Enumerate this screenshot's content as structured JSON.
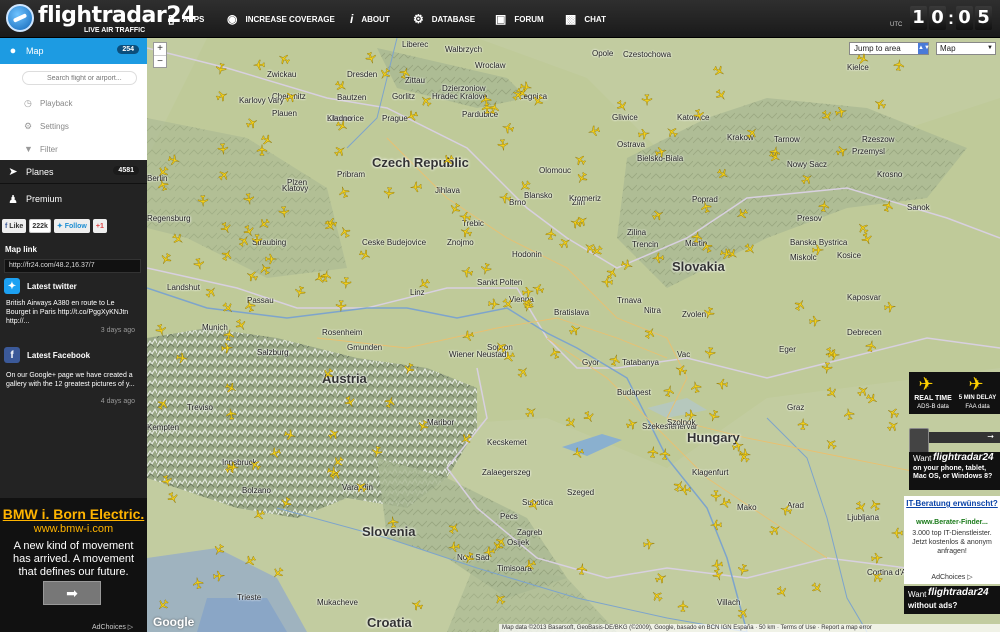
{
  "header": {
    "logo_name": "flightradar24",
    "logo_tagline": "LIVE AIR TRAFFIC",
    "nav": [
      {
        "label": "APPS",
        "icon": "phone-icon"
      },
      {
        "label": "INCREASE COVERAGE",
        "icon": "eye-icon"
      },
      {
        "label": "ABOUT",
        "icon": "info-icon"
      },
      {
        "label": "DATABASE",
        "icon": "database-icon"
      },
      {
        "label": "FORUM",
        "icon": "forum-icon"
      },
      {
        "label": "CHAT",
        "icon": "chat-icon"
      }
    ],
    "utc_label": "UTC",
    "clock": {
      "h1": "1",
      "h2": "0",
      "m1": "0",
      "m2": "5"
    }
  },
  "sidebar": {
    "map_label": "Map",
    "map_count": "254",
    "search_placeholder": "Search flight or airport...",
    "submenu": [
      "Playback",
      "Settings",
      "Filter"
    ],
    "planes_label": "Planes",
    "planes_count": "4581",
    "premium_label": "Premium",
    "social": {
      "like": "Like",
      "like_count": "222k",
      "follow": "Follow",
      "plus": "+1"
    },
    "map_link_title": "Map link",
    "map_link_url": "http://fr24.com/48.2,16.37/7",
    "twitter_title": "Latest twitter",
    "twitter_text": "British Airways A380 en route to Le Bourget in Paris http://t.co/PggXyKNJtn http://...",
    "twitter_date": "3 days ago",
    "facebook_title": "Latest Facebook",
    "facebook_text": "On our Google+ page we have created a gallery with the 12 greatest pictures of y...",
    "facebook_date": "4 days ago"
  },
  "ad": {
    "title": "BMW i. Born Electric.",
    "url": "www.bmw-i.com",
    "body": "A new kind of movement has arrived. A movement that defines our future.",
    "button": "➡",
    "adchoices": "AdChoices ▷"
  },
  "map": {
    "jump_label": "Jump to area",
    "map_type": "Map",
    "zoom_in": "+",
    "zoom_out": "−",
    "google": "Google",
    "attribution": "Map data ©2013 Basarsoft, GeoBasis-DE/BKG (©2009), Google, basado en BCN IGN España · 50 km · Terms of Use · Report a map error",
    "countries": [
      "Czech Republic",
      "Slovakia",
      "Austria",
      "Hungary",
      "Slovenia",
      "Croatia"
    ],
    "cities": [
      "Berlin",
      "Zwickau",
      "Chemnitz",
      "Dresden",
      "Bautzen",
      "Gorlitz",
      "Liberec",
      "Walbrzych",
      "Wroclaw",
      "Opole",
      "Czestochowa",
      "Kielce",
      "Plauen",
      "Litomerice",
      "Zittau",
      "Legnica",
      "Dzierzoniow",
      "Gliwice",
      "Katowice",
      "Krakow",
      "Tarnow",
      "Rzeszow",
      "Przemysl",
      "Karlovy Vary",
      "Kladno",
      "Prague",
      "Hradec Kralove",
      "Pardubice",
      "Ostrava",
      "Bielsko-Biala",
      "Nowy Sacz",
      "Krosno",
      "Sanok",
      "Plzen",
      "Klatovy",
      "Pribram",
      "Jihlava",
      "Olomouc",
      "Zlin",
      "Blansko",
      "Brno",
      "Kromeriz",
      "Zilina",
      "Poprad",
      "Presov",
      "Kosice",
      "Regensburg",
      "Straubing",
      "Ceske Budejovice",
      "Trebic",
      "Znojmo",
      "Hodonin",
      "Trencin",
      "Martin",
      "Banska Bystrica",
      "Miskolc",
      "Landshut",
      "Passau",
      "Linz",
      "Sankt Polten",
      "Vienna",
      "Bratislava",
      "Trnava",
      "Nitra",
      "Zvolen",
      "Munich",
      "Rosenheim",
      "Salzburg",
      "Gmunden",
      "Wiener Neustadt",
      "Sopron",
      "Gyor",
      "Tatabanya",
      "Vac",
      "Eger",
      "Debrecen",
      "Budapest",
      "Szekesfehervar",
      "Szolnok",
      "Graz",
      "Maribor",
      "Zalaegerszeg",
      "Kecskemet",
      "Klagenfurt",
      "Varazdin",
      "Pecs",
      "Szeged",
      "Arad",
      "Ljubljana",
      "Zagreb",
      "Osijek",
      "Novi Sad",
      "Timisoara",
      "Villach",
      "Cortina d'Ampezzo",
      "Bolzano",
      "Innsbruck",
      "Kempten",
      "Treviso",
      "Trieste",
      "Mukacheve",
      "Kaposvar",
      "Subotica",
      "Mako"
    ]
  },
  "right_ads": {
    "realtime_title": "REAL TIME",
    "realtime_sub": "ADS-B data",
    "delay_title": "5 MIN DELAY",
    "delay_sub": "FAA data",
    "app_want": "Want",
    "app_brand": "flightradar24",
    "app_text": "on your phone, tablet, Mac OS, or Windows 8?",
    "it_title": "IT-Beratung erwünscht?",
    "it_url": "www.Berater-Finder...",
    "it_body": "3.000 top IT-Dienstleister. Jetzt kostenlos & anonym anfragen!",
    "it_adchoices": "AdChoices ▷",
    "noads_want": "Want",
    "noads_brand": "flightradar24",
    "noads_text": "without ads?"
  }
}
